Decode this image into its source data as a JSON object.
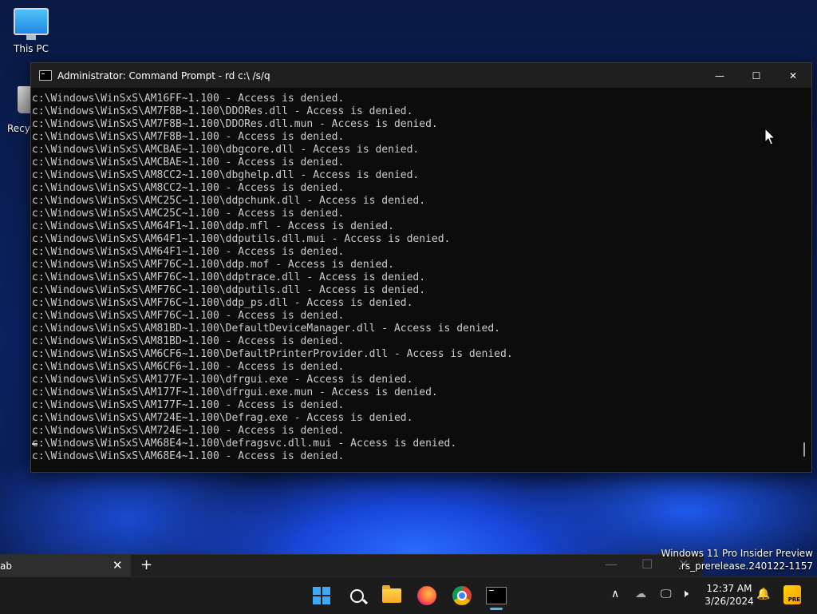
{
  "desktop": {
    "this_pc_label": "This PC",
    "recycle_bin_label": "Recyc"
  },
  "window": {
    "title": "Administrator: Command Prompt - rd  c:\\ /s/q",
    "minimize_glyph": "—",
    "maximize_glyph": "☐",
    "close_glyph": "✕"
  },
  "console": {
    "lines": [
      "c:\\Windows\\WinSxS\\AM16FF~1.100 - Access is denied.",
      "c:\\Windows\\WinSxS\\AM7F8B~1.100\\DDORes.dll - Access is denied.",
      "c:\\Windows\\WinSxS\\AM7F8B~1.100\\DDORes.dll.mun - Access is denied.",
      "c:\\Windows\\WinSxS\\AM7F8B~1.100 - Access is denied.",
      "c:\\Windows\\WinSxS\\AMCBAE~1.100\\dbgcore.dll - Access is denied.",
      "c:\\Windows\\WinSxS\\AMCBAE~1.100 - Access is denied.",
      "c:\\Windows\\WinSxS\\AM8CC2~1.100\\dbghelp.dll - Access is denied.",
      "c:\\Windows\\WinSxS\\AM8CC2~1.100 - Access is denied.",
      "c:\\Windows\\WinSxS\\AMC25C~1.100\\ddpchunk.dll - Access is denied.",
      "c:\\Windows\\WinSxS\\AMC25C~1.100 - Access is denied.",
      "c:\\Windows\\WinSxS\\AM64F1~1.100\\ddp.mfl - Access is denied.",
      "c:\\Windows\\WinSxS\\AM64F1~1.100\\ddputils.dll.mui - Access is denied.",
      "c:\\Windows\\WinSxS\\AM64F1~1.100 - Access is denied.",
      "c:\\Windows\\WinSxS\\AMF76C~1.100\\ddp.mof - Access is denied.",
      "c:\\Windows\\WinSxS\\AMF76C~1.100\\ddptrace.dll - Access is denied.",
      "c:\\Windows\\WinSxS\\AMF76C~1.100\\ddputils.dll - Access is denied.",
      "c:\\Windows\\WinSxS\\AMF76C~1.100\\ddp_ps.dll - Access is denied.",
      "c:\\Windows\\WinSxS\\AMF76C~1.100 - Access is denied.",
      "c:\\Windows\\WinSxS\\AM81BD~1.100\\DefaultDeviceManager.dll - Access is denied.",
      "c:\\Windows\\WinSxS\\AM81BD~1.100 - Access is denied.",
      "c:\\Windows\\WinSxS\\AM6CF6~1.100\\DefaultPrinterProvider.dll - Access is denied.",
      "c:\\Windows\\WinSxS\\AM6CF6~1.100 - Access is denied.",
      "c:\\Windows\\WinSxS\\AM177F~1.100\\dfrgui.exe - Access is denied.",
      "c:\\Windows\\WinSxS\\AM177F~1.100\\dfrgui.exe.mun - Access is denied.",
      "c:\\Windows\\WinSxS\\AM177F~1.100 - Access is denied.",
      "c:\\Windows\\WinSxS\\AM724E~1.100\\Defrag.exe - Access is denied.",
      "c:\\Windows\\WinSxS\\AM724E~1.100 - Access is denied.",
      "c:\\Windows\\WinSxS\\AM68E4~1.100\\defragsvc.dll.mui - Access is denied.",
      "c:\\Windows\\WinSxS\\AM68E4~1.100 - Access is denied."
    ]
  },
  "tabbar": {
    "tab_label": "ab",
    "close_glyph": "✕",
    "add_glyph": "+",
    "minimize_glyph": "—",
    "maximize_glyph": "☐",
    "close_window_glyph": "✕"
  },
  "watermark": {
    "line1": "Windows 11 Pro Insider Preview",
    "line2": ".rs_prerelease.240122-1157"
  },
  "taskbar": {
    "chevron_glyph": "∧",
    "cloud_glyph": "☁",
    "network_glyph": "🖵",
    "volume_glyph": "🕨",
    "time": "12:37 AM",
    "date": "3/26/2024",
    "bell_glyph": "🔔",
    "pre_badge": "PRE"
  },
  "colors": {
    "accent": "#3fa9f5",
    "console_text": "#cccccc",
    "console_bg": "#0c0c0c"
  }
}
